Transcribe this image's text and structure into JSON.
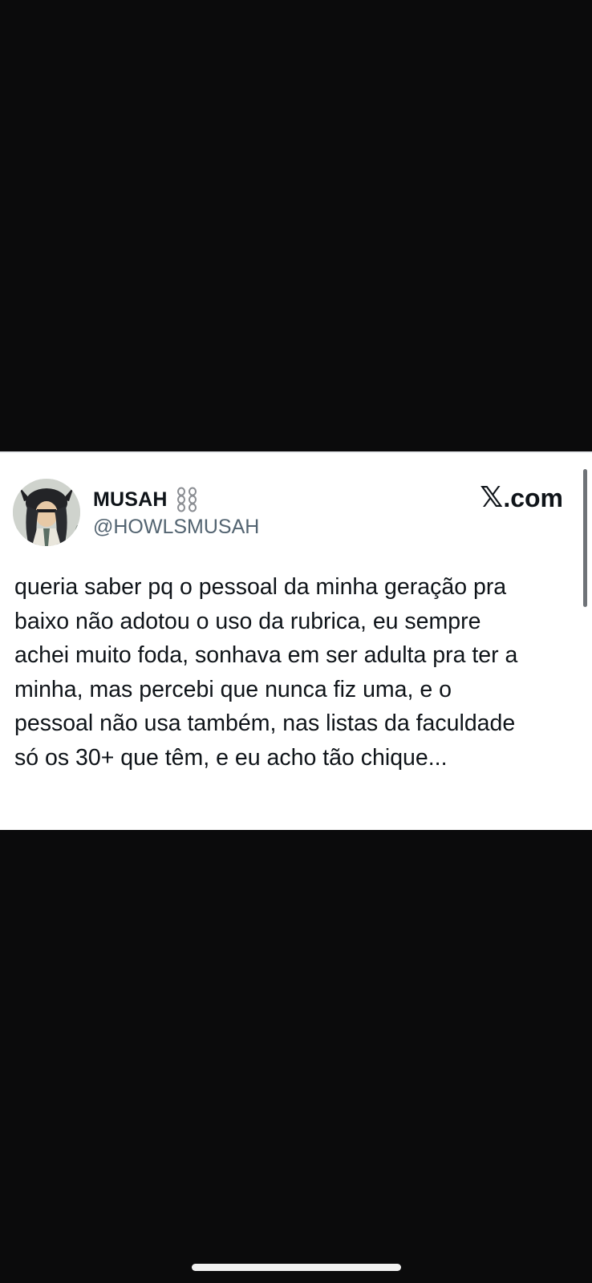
{
  "tweet": {
    "display_name": "MUSAH",
    "name_badge_icon": "chain-link-icon",
    "handle": "@HOWLSMUSAH",
    "brand_logo": "𝕏",
    "brand_domain": ".com",
    "avatar_icon": "profile-avatar",
    "text": "queria saber pq o pessoal da minha geração pra\nbaixo não adotou o uso da rubrica, eu sempre\nachei muito foda, sonhava em ser adulta pra ter a\nminha, mas percebi que nunca fiz uma, e o\npessoal não usa também, nas listas da faculdade\nsó os 30+ que têm, e eu acho tão chique..."
  },
  "colors": {
    "background": "#0b0b0c",
    "card": "#ffffff",
    "text_primary": "#0f1419",
    "text_secondary": "#536471"
  }
}
